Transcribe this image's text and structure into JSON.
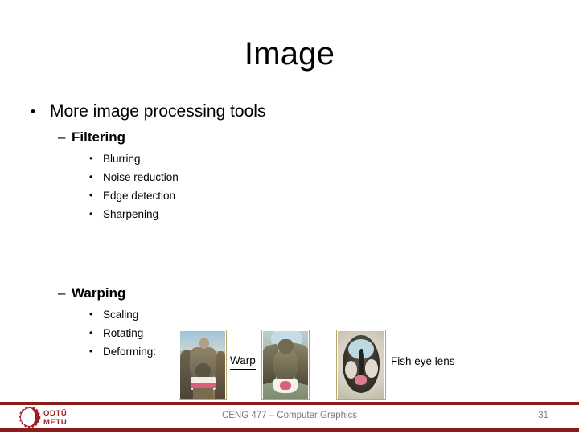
{
  "slide": {
    "title": "Image",
    "outline": {
      "level1": {
        "marker": "•",
        "text": "More image processing tools"
      },
      "sections": [
        {
          "marker": "–",
          "heading": "Filtering",
          "items": [
            {
              "marker": "•",
              "text": "Blurring"
            },
            {
              "marker": "•",
              "text": "Noise reduction"
            },
            {
              "marker": "•",
              "text": "Edge detection"
            },
            {
              "marker": "•",
              "text": "Sharpening"
            }
          ]
        },
        {
          "marker": "–",
          "heading": "Warping",
          "items": [
            {
              "marker": "•",
              "text": "Scaling"
            },
            {
              "marker": "•",
              "text": "Rotating"
            },
            {
              "marker": "•",
              "text": "Deforming:"
            }
          ]
        }
      ]
    },
    "figures": {
      "original_photo_alt": "photo-original-beach",
      "warped_photo_alt": "photo-warped-beach",
      "fisheye_photo_alt": "photo-fisheye-beach",
      "warp_label": "Warp",
      "fisheye_label": "Fish eye lens"
    },
    "footer": {
      "logo_line1": "ODTÜ",
      "logo_line2": "METU",
      "center_text": "CENG 477 – Computer Graphics",
      "page_number": "31",
      "accent_color": "#8c1b1b",
      "text_color": "#7a7a7a"
    }
  }
}
